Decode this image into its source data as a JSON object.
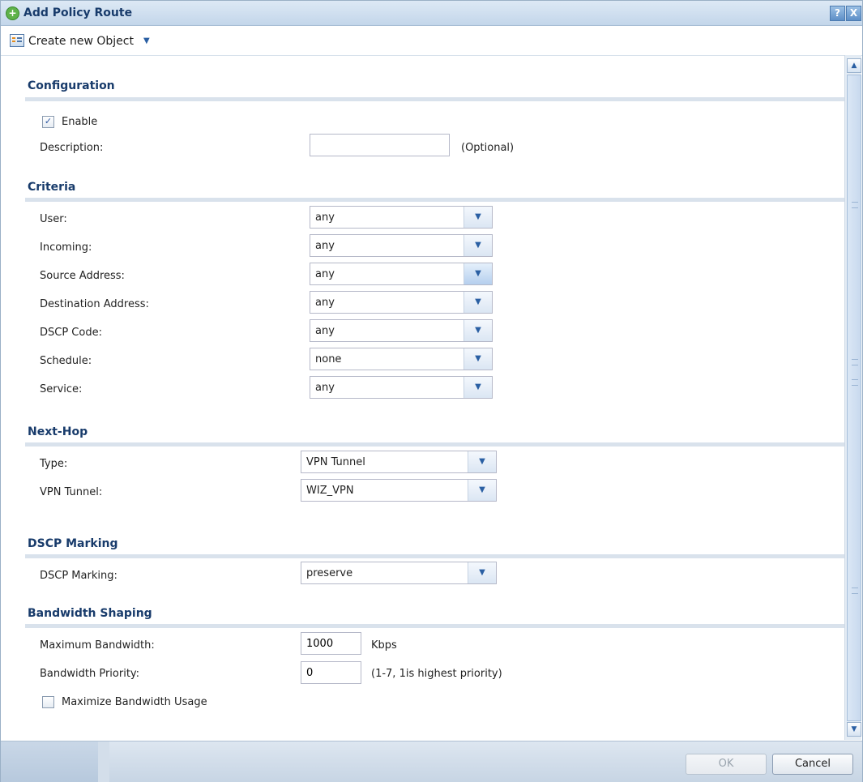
{
  "window": {
    "title": "Add Policy Route",
    "help": "?",
    "close": "X"
  },
  "toolbar": {
    "create_label": "Create new Object"
  },
  "configuration": {
    "title": "Configuration",
    "enable_label": "Enable",
    "enable_checked": true,
    "description_label": "Description:",
    "description_value": "",
    "description_hint": "(Optional)"
  },
  "criteria": {
    "title": "Criteria",
    "rows": [
      {
        "label": "User:",
        "value": "any"
      },
      {
        "label": "Incoming:",
        "value": "any"
      },
      {
        "label": "Source Address:",
        "value": "any"
      },
      {
        "label": "Destination Address:",
        "value": "any"
      },
      {
        "label": "DSCP Code:",
        "value": "any"
      },
      {
        "label": "Schedule:",
        "value": "none"
      },
      {
        "label": "Service:",
        "value": "any"
      }
    ]
  },
  "nexthop": {
    "title": "Next-Hop",
    "type_label": "Type:",
    "type_value": "VPN Tunnel",
    "tunnel_label": "VPN Tunnel:",
    "tunnel_value": "WIZ_VPN"
  },
  "dscp": {
    "title": "DSCP Marking",
    "label": "DSCP Marking:",
    "value": "preserve"
  },
  "bandwidth": {
    "title": "Bandwidth Shaping",
    "max_label": "Maximum Bandwidth:",
    "max_value": "1000",
    "max_unit": "Kbps",
    "priority_label": "Bandwidth Priority:",
    "priority_value": "0",
    "priority_hint": "(1-7, 1is highest priority)",
    "maximize_label": "Maximize Bandwidth Usage",
    "maximize_checked": false
  },
  "footer": {
    "ok_label": "OK",
    "cancel_label": "Cancel"
  },
  "icons": {
    "title": "add-circle-icon",
    "toolbar": "object-list-icon",
    "dropdown": "chevron-down-icon"
  }
}
